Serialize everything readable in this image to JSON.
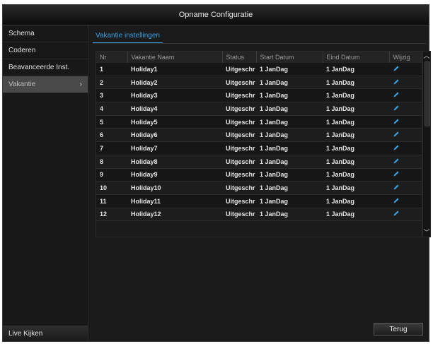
{
  "window": {
    "title": "Opname Configuratie"
  },
  "sidebar": {
    "items": [
      {
        "label": "Schema",
        "active": false
      },
      {
        "label": "Coderen",
        "active": false
      },
      {
        "label": "Beavanceerde Inst.",
        "active": false
      },
      {
        "label": "Vakantie",
        "active": true,
        "chevron": "›"
      }
    ],
    "footer_label": "Live Kijken"
  },
  "main": {
    "tab_label": "Vakantie instellingen",
    "table": {
      "headers": [
        "Nr",
        "Vakantie Naam",
        "Status",
        "Start Datum",
        "Eind Datum",
        "Wijzig"
      ],
      "rows": [
        {
          "nr": "1",
          "name": "Holiday1",
          "status": "Uitgeschr",
          "start": "1 JanDag",
          "end": "1 JanDag"
        },
        {
          "nr": "2",
          "name": "Holiday2",
          "status": "Uitgeschr",
          "start": "1 JanDag",
          "end": "1 JanDag"
        },
        {
          "nr": "3",
          "name": "Holiday3",
          "status": "Uitgeschr",
          "start": "1 JanDag",
          "end": "1 JanDag"
        },
        {
          "nr": "4",
          "name": "Holiday4",
          "status": "Uitgeschr",
          "start": "1 JanDag",
          "end": "1 JanDag"
        },
        {
          "nr": "5",
          "name": "Holiday5",
          "status": "Uitgeschr",
          "start": "1 JanDag",
          "end": "1 JanDag"
        },
        {
          "nr": "6",
          "name": "Holiday6",
          "status": "Uitgeschr",
          "start": "1 JanDag",
          "end": "1 JanDag"
        },
        {
          "nr": "7",
          "name": "Holiday7",
          "status": "Uitgeschr",
          "start": "1 JanDag",
          "end": "1 JanDag"
        },
        {
          "nr": "8",
          "name": "Holiday8",
          "status": "Uitgeschr",
          "start": "1 JanDag",
          "end": "1 JanDag"
        },
        {
          "nr": "9",
          "name": "Holiday9",
          "status": "Uitgeschr",
          "start": "1 JanDag",
          "end": "1 JanDag"
        },
        {
          "nr": "10",
          "name": "Holiday10",
          "status": "Uitgeschr",
          "start": "1 JanDag",
          "end": "1 JanDag"
        },
        {
          "nr": "11",
          "name": "Holiday11",
          "status": "Uitgeschr",
          "start": "1 JanDag",
          "end": "1 JanDag"
        },
        {
          "nr": "12",
          "name": "Holiday12",
          "status": "Uitgeschr",
          "start": "1 JanDag",
          "end": "1 JanDag"
        }
      ],
      "edit_icon": "pencil-icon"
    },
    "back_label": "Terug"
  },
  "colors": {
    "accent": "#3aa0e0",
    "background": "#1b1b1b",
    "active_item": "#4a4a4a"
  }
}
